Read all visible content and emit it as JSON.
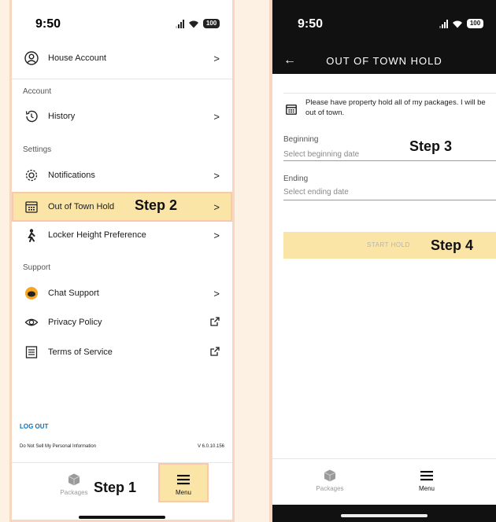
{
  "menu_screen": {
    "status": {
      "time": "9:50",
      "battery": "100"
    },
    "house_account": "House Account",
    "sections": {
      "account": "Account",
      "settings": "Settings",
      "support": "Support"
    },
    "items": {
      "history": "History",
      "notifications": "Notifications",
      "out_of_town_hold": "Out of Town Hold",
      "locker_height": "Locker Height Preference",
      "chat_support": "Chat Support",
      "privacy_policy": "Privacy Policy",
      "terms_of_service": "Terms of Service"
    },
    "logout": "LOG OUT",
    "do_not_sell": "Do Not Sell My Personal Information",
    "version": "V 6.0.10.156",
    "tabs": {
      "packages": "Packages",
      "menu": "Menu"
    }
  },
  "hold_screen": {
    "status": {
      "time": "9:50",
      "battery": "100"
    },
    "title": "OUT OF TOWN HOLD",
    "notice": "Please have property hold all of my packages. I will be out of town.",
    "beginning_label": "Beginning",
    "beginning_placeholder": "Select beginning date",
    "ending_label": "Ending",
    "ending_placeholder": "Select ending date",
    "start_button": "START HOLD",
    "tabs": {
      "packages": "Packages",
      "menu": "Menu"
    }
  },
  "annotations": {
    "step1": "Step 1",
    "step2": "Step 2",
    "step3": "Step 3",
    "step4": "Step 4"
  },
  "colors": {
    "highlight": "#fbe5a6",
    "border": "#f8d6bf",
    "background": "#fdf1e4",
    "dark_bar": "#111111"
  }
}
